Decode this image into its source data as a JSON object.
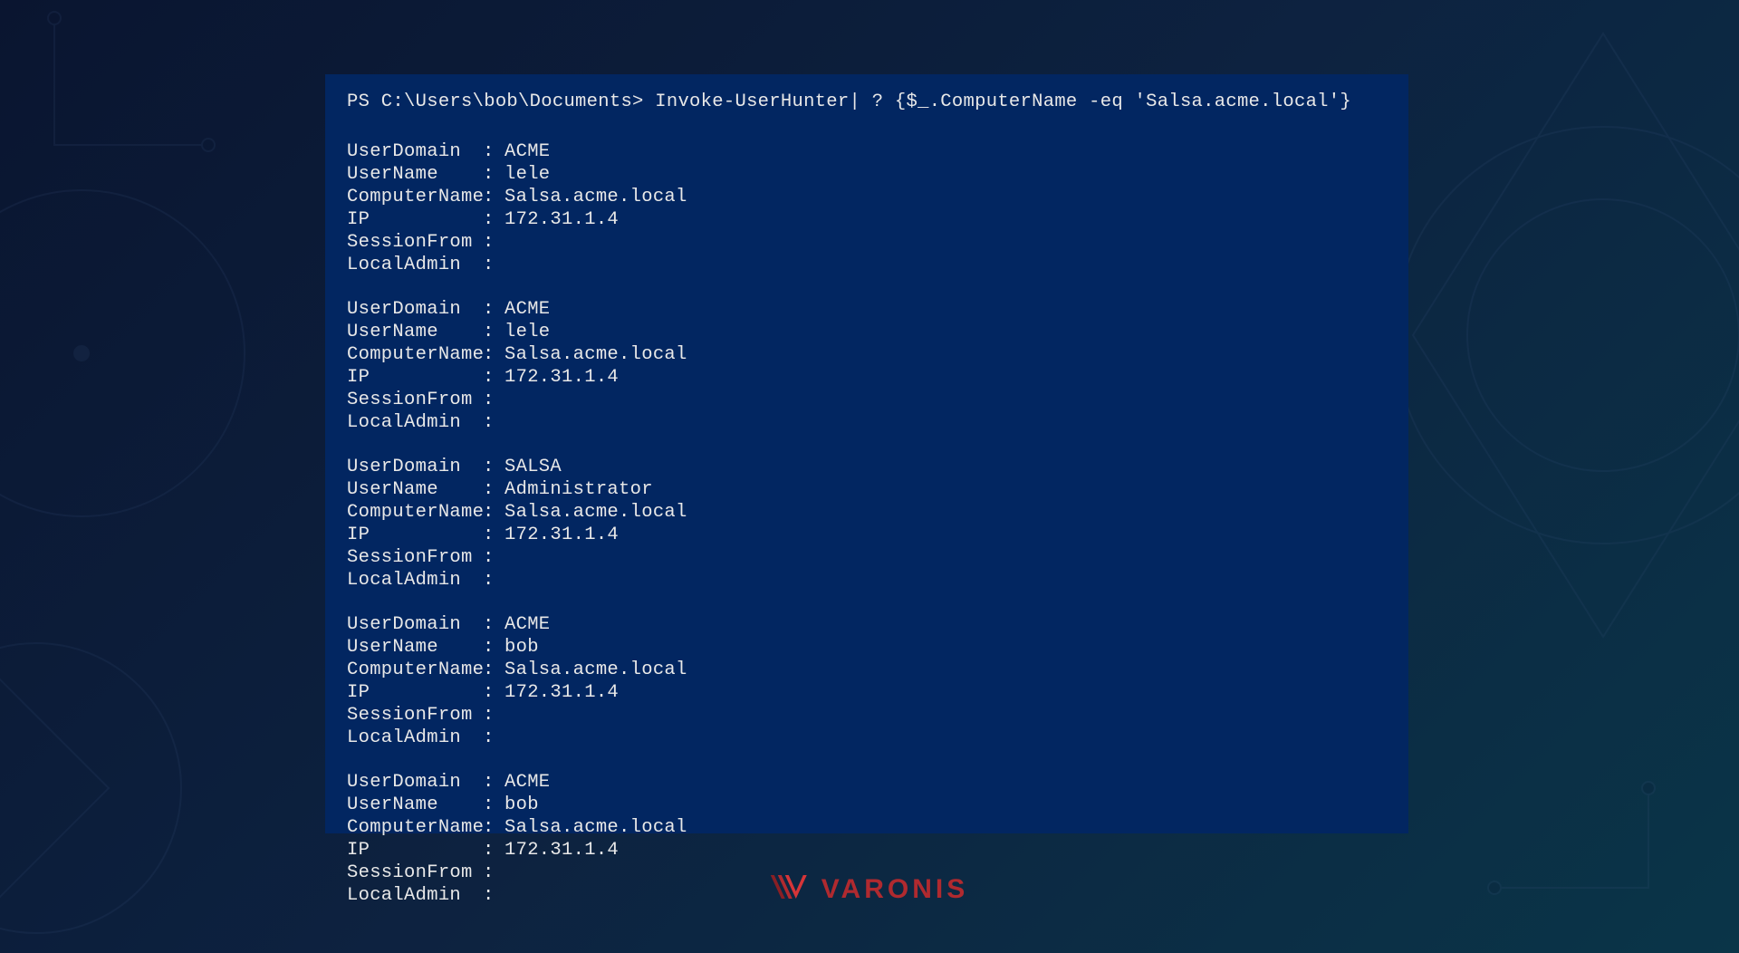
{
  "terminal": {
    "prompt": "PS C:\\Users\\bob\\Documents> Invoke-UserHunter| ? {$_.ComputerName -eq 'Salsa.acme.local'}",
    "fields": [
      "UserDomain",
      "UserName",
      "ComputerName",
      "IP",
      "SessionFrom",
      "LocalAdmin"
    ],
    "records": [
      {
        "UserDomain": "ACME",
        "UserName": "lele",
        "ComputerName": "Salsa.acme.local",
        "IP": "172.31.1.4",
        "SessionFrom": "",
        "LocalAdmin": ""
      },
      {
        "UserDomain": "ACME",
        "UserName": "lele",
        "ComputerName": "Salsa.acme.local",
        "IP": "172.31.1.4",
        "SessionFrom": "",
        "LocalAdmin": ""
      },
      {
        "UserDomain": "SALSA",
        "UserName": "Administrator",
        "ComputerName": "Salsa.acme.local",
        "IP": "172.31.1.4",
        "SessionFrom": "",
        "LocalAdmin": ""
      },
      {
        "UserDomain": "ACME",
        "UserName": "bob",
        "ComputerName": "Salsa.acme.local",
        "IP": "172.31.1.4",
        "SessionFrom": "",
        "LocalAdmin": ""
      },
      {
        "UserDomain": "ACME",
        "UserName": "bob",
        "ComputerName": "Salsa.acme.local",
        "IP": "172.31.1.4",
        "SessionFrom": "",
        "LocalAdmin": ""
      }
    ]
  },
  "logo": {
    "text": "VARONIS"
  }
}
